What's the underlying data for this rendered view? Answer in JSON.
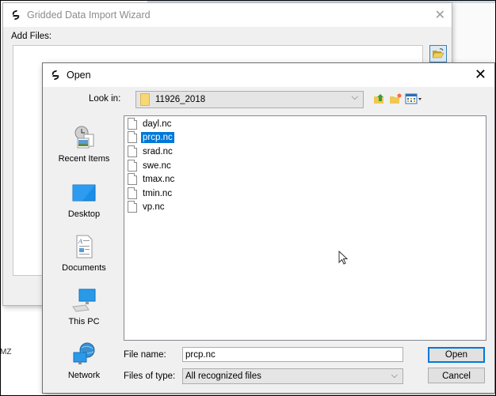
{
  "wizard": {
    "title": "Gridded Data Import Wizard",
    "add_files_label": "Add Files:",
    "close_glyph": "✕",
    "browse_icon": "open-folder-icon"
  },
  "dialog": {
    "title": "Open",
    "close_glyph": "✕",
    "look_in_label": "Look in:",
    "look_in_value": "11926_2018",
    "toolbar": {
      "up_icon": "up-folder-icon",
      "new_folder_icon": "new-folder-icon",
      "view_menu_icon": "view-menu-icon"
    },
    "places": [
      {
        "label": "Recent Items",
        "icon": "recent-items-icon"
      },
      {
        "label": "Desktop",
        "icon": "desktop-icon"
      },
      {
        "label": "Documents",
        "icon": "documents-icon"
      },
      {
        "label": "This PC",
        "icon": "this-pc-icon"
      },
      {
        "label": "Network",
        "icon": "network-icon"
      }
    ],
    "files": [
      {
        "name": "dayl.nc",
        "selected": false
      },
      {
        "name": "prcp.nc",
        "selected": true
      },
      {
        "name": "srad.nc",
        "selected": false
      },
      {
        "name": "swe.nc",
        "selected": false
      },
      {
        "name": "tmax.nc",
        "selected": false
      },
      {
        "name": "tmin.nc",
        "selected": false
      },
      {
        "name": "vp.nc",
        "selected": false
      }
    ],
    "file_name_label": "File name:",
    "file_name_value": "prcp.nc",
    "files_of_type_label": "Files of type:",
    "files_of_type_value": "All recognized files",
    "open_button": "Open",
    "cancel_button": "Cancel",
    "chevron": "⌵"
  },
  "background": {
    "left_fragment": "MZ"
  }
}
